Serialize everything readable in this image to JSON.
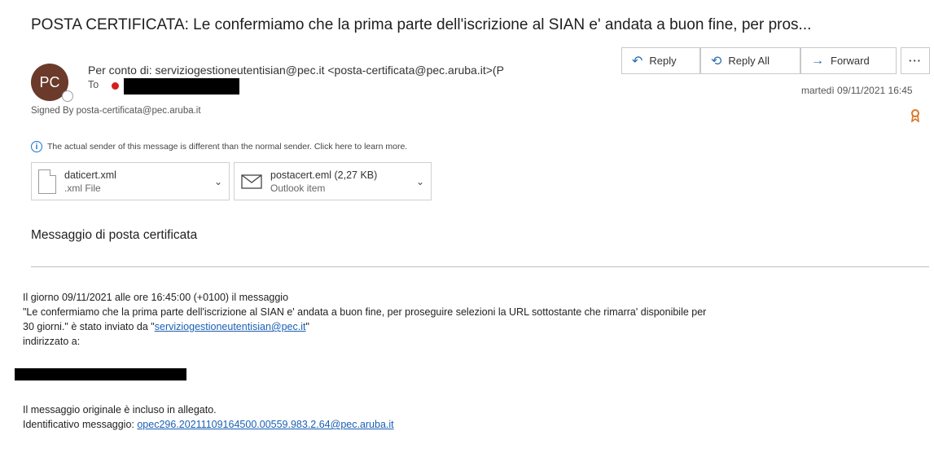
{
  "subject": "POSTA CERTIFICATA: Le confermiamo che la prima parte dell'iscrizione al SIAN e' andata a buon fine, per pros...",
  "sender": {
    "initials": "PC",
    "from_line": "Per conto di: serviziogestioneutentisian@pec.it <posta-certificata@pec.aruba.it>(P",
    "to_label": "To",
    "signed_by": "Signed By  posta-certificata@pec.aruba.it"
  },
  "actions": {
    "reply": "Reply",
    "reply_all": "Reply All",
    "forward": "Forward",
    "more": "···"
  },
  "date": "martedì 09/11/2021 16:45",
  "info_bar": "The actual sender of this message is different than the normal sender. Click here to learn more.",
  "attachments": [
    {
      "name": "daticert.xml",
      "type": ".xml File"
    },
    {
      "name": "postacert.eml (2,27 KB)",
      "type": "Outlook item"
    }
  ],
  "body": {
    "heading": "Messaggio di posta certificata",
    "line1": "Il giorno 09/11/2021 alle ore 16:45:00 (+0100) il messaggio",
    "line2": "\"Le confermiamo che la prima parte dell'iscrizione al SIAN e' andata a buon fine, per proseguire selezioni la URL sottostante che rimarra' disponibile per",
    "line3_prefix": "30 giorni.\" è stato inviato da \"",
    "line3_link": "serviziogestioneutentisian@pec.it",
    "line3_suffix": "\"",
    "line4": "indirizzato a:",
    "line5": "Il messaggio originale è incluso in allegato.",
    "line6_prefix": "Identificativo messaggio: ",
    "line6_link": "opec296.20211109164500.00559.983.2.64@pec.aruba.it"
  }
}
